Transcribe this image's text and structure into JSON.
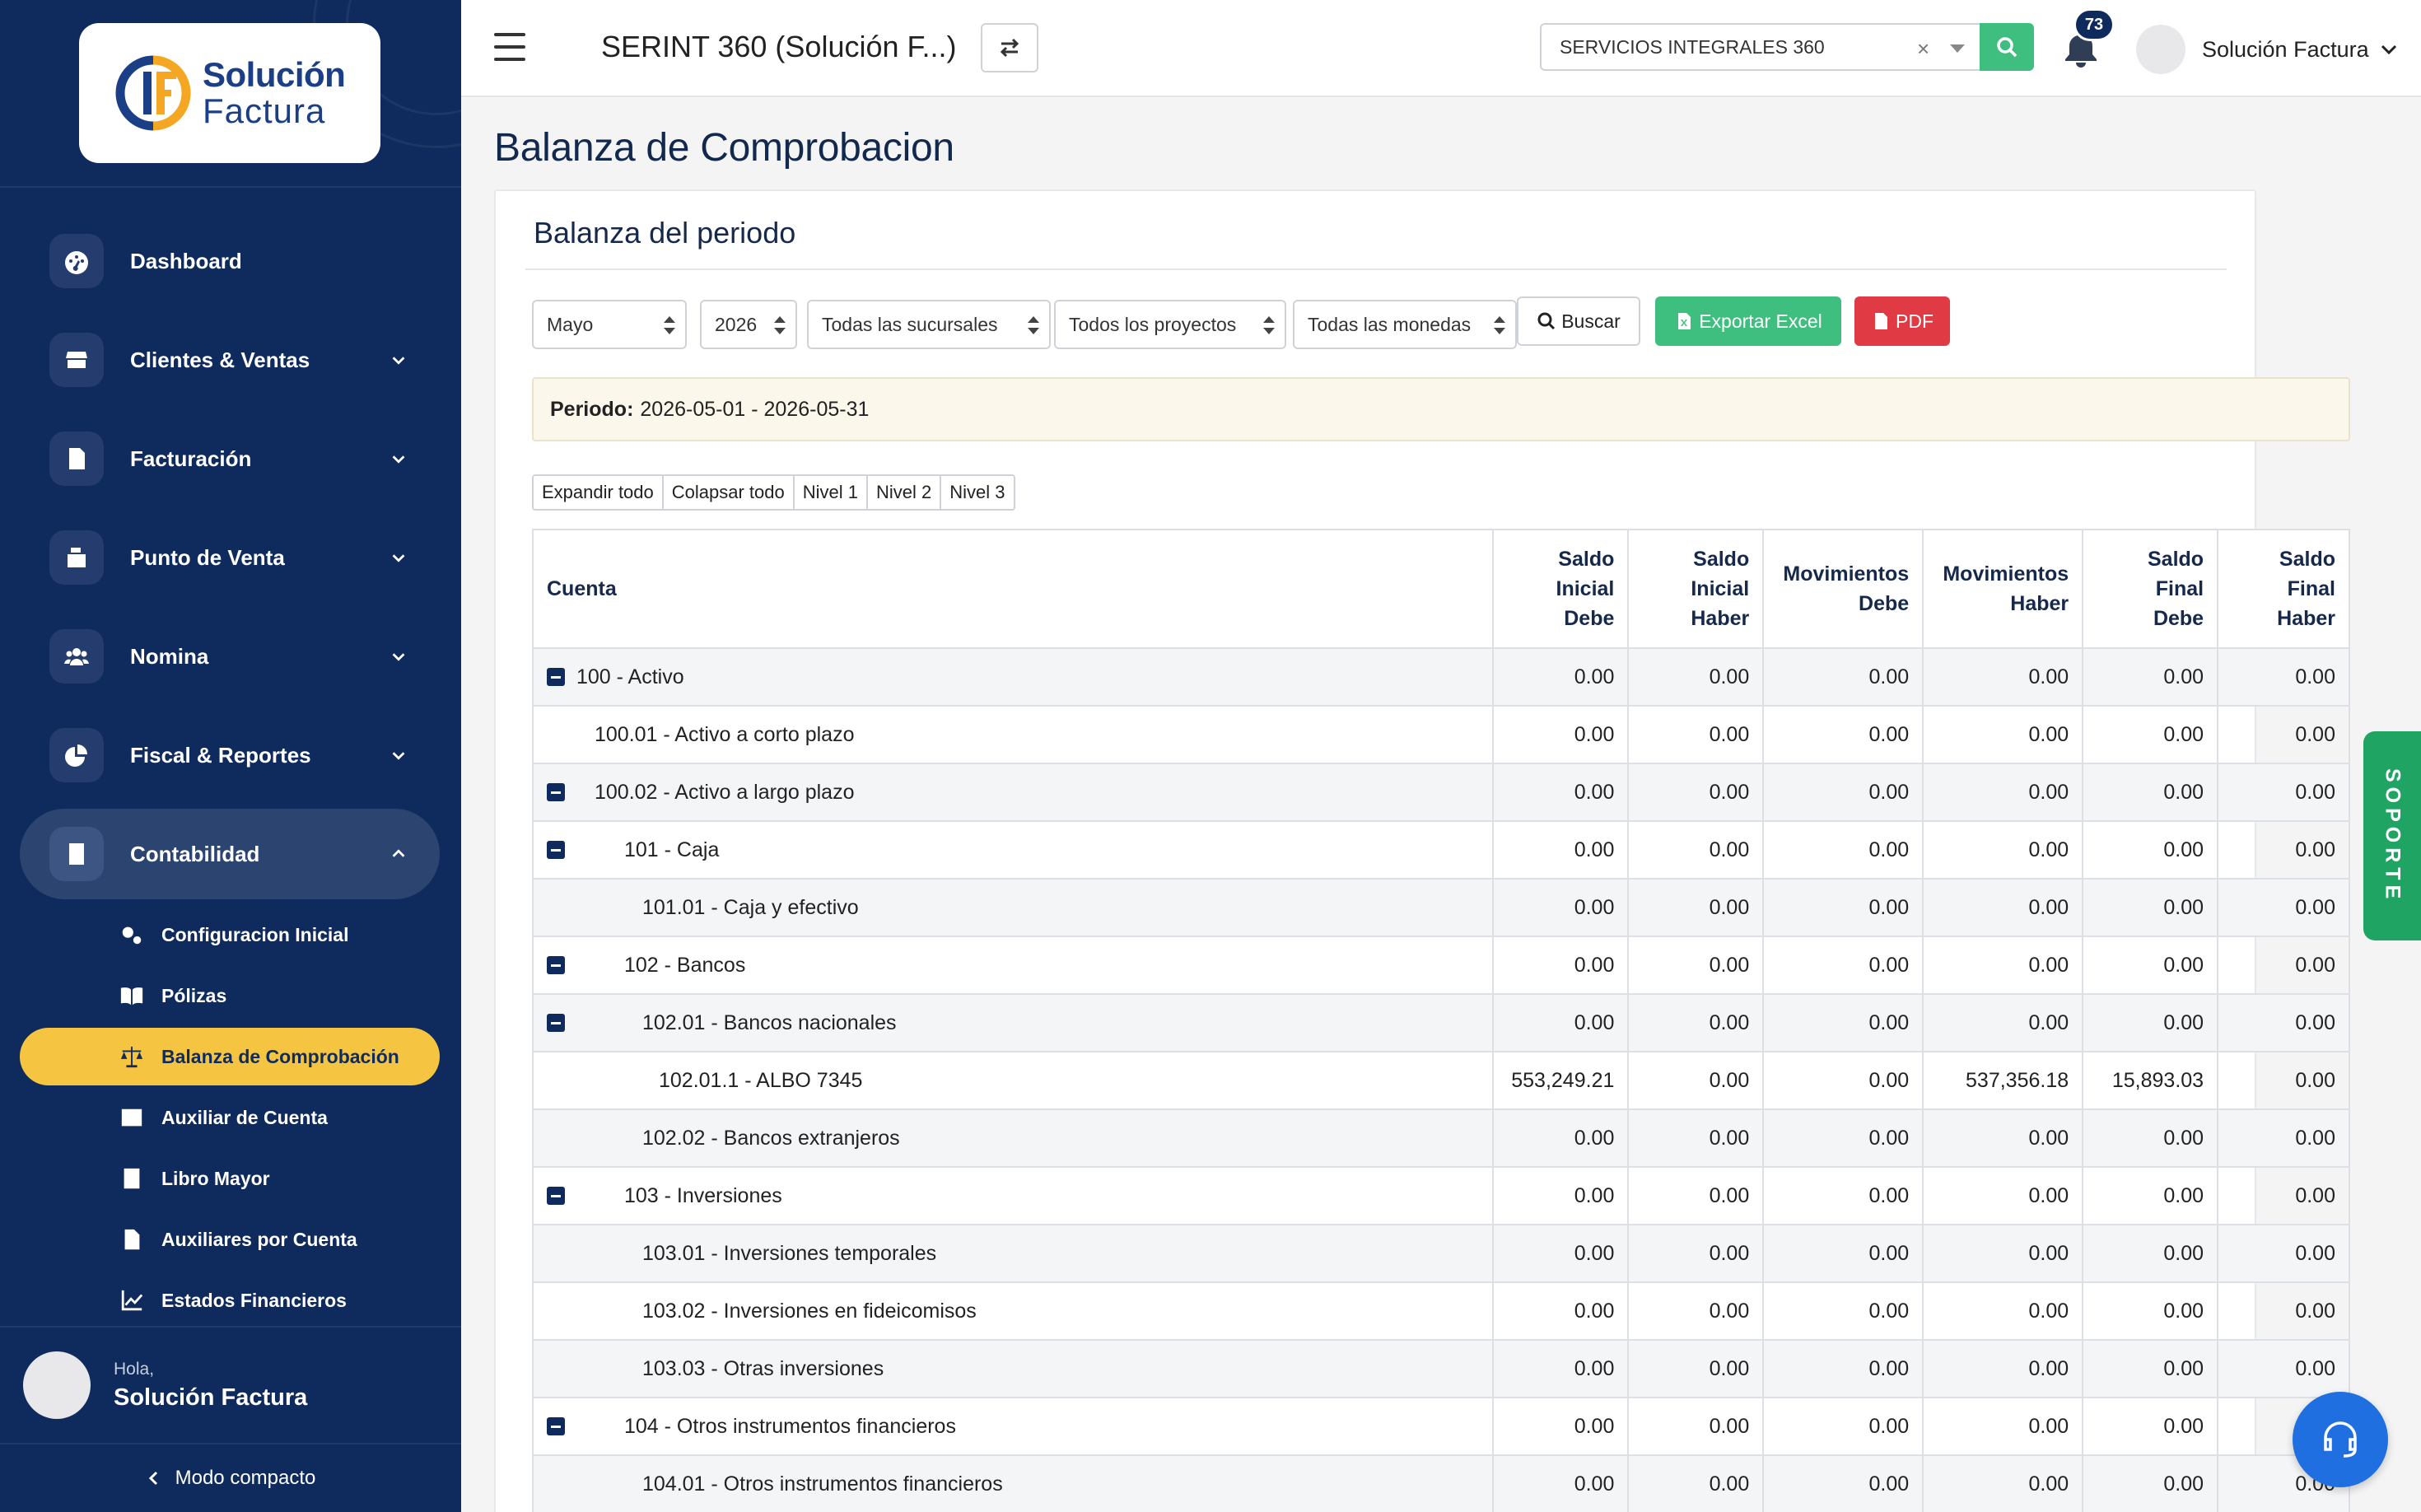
{
  "brand": {
    "logo_line1": "Solución",
    "logo_line2": "Factura"
  },
  "sidebar": {
    "nav": [
      {
        "label": "Dashboard",
        "icon": "dashboard-icon",
        "expandable": false
      },
      {
        "label": "Clientes & Ventas",
        "icon": "store-icon",
        "expandable": true
      },
      {
        "label": "Facturación",
        "icon": "invoice-icon",
        "expandable": true
      },
      {
        "label": "Punto de Venta",
        "icon": "cash-register-icon",
        "expandable": true
      },
      {
        "label": "Nomina",
        "icon": "users-icon",
        "expandable": true
      },
      {
        "label": "Fiscal & Reportes",
        "icon": "pie-chart-icon",
        "expandable": true
      },
      {
        "label": "Contabilidad",
        "icon": "ledger-icon",
        "expandable": true,
        "open": true
      }
    ],
    "sub": [
      {
        "label": "Configuracion Inicial",
        "icon": "cogs-icon"
      },
      {
        "label": "Pólizas",
        "icon": "book-open-icon"
      },
      {
        "label": "Balanza de Comprobación",
        "icon": "scale-icon",
        "active": true
      },
      {
        "label": "Auxiliar de Cuenta",
        "icon": "list-icon"
      },
      {
        "label": "Libro Mayor",
        "icon": "book-icon"
      },
      {
        "label": "Auxiliares por Cuenta",
        "icon": "file-icon"
      },
      {
        "label": "Estados Financieros",
        "icon": "line-chart-icon"
      }
    ],
    "user": {
      "greeting": "Hola,",
      "name": "Solución Factura"
    },
    "compact_label": "Modo compacto"
  },
  "topbar": {
    "company_title": "SERINT 360 (Solución F...)",
    "company_select": "SERVICIOS INTEGRALES 360",
    "notifications": "73",
    "user_name": "Solución Factura"
  },
  "page": {
    "title": "Balanza de Comprobacion",
    "card_title": "Balanza del periodo",
    "filters": {
      "month": "Mayo",
      "year": "2026",
      "branch": "Todas las sucursales",
      "project": "Todos los proyectos",
      "currency": "Todas las monedas"
    },
    "buttons": {
      "search": "Buscar",
      "excel": "Exportar Excel",
      "pdf": "PDF"
    },
    "period_label": "Periodo:",
    "period_value": "2026-05-01 - 2026-05-31",
    "levels": [
      "Expandir todo",
      "Colapsar todo",
      "Nivel 1",
      "Nivel 2",
      "Nivel 3"
    ]
  },
  "table": {
    "headers": {
      "account": "Cuenta",
      "cols": [
        [
          "Saldo",
          "Inicial",
          "Debe"
        ],
        [
          "Saldo",
          "Inicial",
          "Haber"
        ],
        [
          "Movimientos",
          "Debe"
        ],
        [
          "Movimientos",
          "Haber"
        ],
        [
          "Saldo",
          "Final",
          "Debe"
        ],
        [
          "Saldo",
          "Final",
          "Haber"
        ]
      ]
    },
    "rows": [
      {
        "account": "100 - Activo",
        "level": 0,
        "toggle": true,
        "values": [
          "0.00",
          "0.00",
          "0.00",
          "0.00",
          "0.00",
          "0.00"
        ]
      },
      {
        "account": "100.01 - Activo a corto plazo",
        "level": 1,
        "toggle": false,
        "values": [
          "0.00",
          "0.00",
          "0.00",
          "0.00",
          "0.00",
          "0.00"
        ]
      },
      {
        "account": "100.02 - Activo a largo plazo",
        "level": 1,
        "toggle": true,
        "values": [
          "0.00",
          "0.00",
          "0.00",
          "0.00",
          "0.00",
          "0.00"
        ]
      },
      {
        "account": "101 - Caja",
        "level": 2,
        "toggle": true,
        "values": [
          "0.00",
          "0.00",
          "0.00",
          "0.00",
          "0.00",
          "0.00"
        ]
      },
      {
        "account": "101.01 - Caja y efectivo",
        "level": 3,
        "toggle": false,
        "values": [
          "0.00",
          "0.00",
          "0.00",
          "0.00",
          "0.00",
          "0.00"
        ]
      },
      {
        "account": "102 - Bancos",
        "level": 2,
        "toggle": true,
        "values": [
          "0.00",
          "0.00",
          "0.00",
          "0.00",
          "0.00",
          "0.00"
        ]
      },
      {
        "account": "102.01 - Bancos nacionales",
        "level": 3,
        "toggle": true,
        "values": [
          "0.00",
          "0.00",
          "0.00",
          "0.00",
          "0.00",
          "0.00"
        ]
      },
      {
        "account": "102.01.1 - ALBO 7345",
        "level": 4,
        "toggle": false,
        "values": [
          "553,249.21",
          "0.00",
          "0.00",
          "537,356.18",
          "15,893.03",
          "0.00"
        ]
      },
      {
        "account": "102.02 - Bancos extranjeros",
        "level": 3,
        "toggle": false,
        "values": [
          "0.00",
          "0.00",
          "0.00",
          "0.00",
          "0.00",
          "0.00"
        ]
      },
      {
        "account": "103 - Inversiones",
        "level": 2,
        "toggle": true,
        "values": [
          "0.00",
          "0.00",
          "0.00",
          "0.00",
          "0.00",
          "0.00"
        ]
      },
      {
        "account": "103.01 - Inversiones temporales",
        "level": 3,
        "toggle": false,
        "values": [
          "0.00",
          "0.00",
          "0.00",
          "0.00",
          "0.00",
          "0.00"
        ]
      },
      {
        "account": "103.02 - Inversiones en fideicomisos",
        "level": 3,
        "toggle": false,
        "values": [
          "0.00",
          "0.00",
          "0.00",
          "0.00",
          "0.00",
          "0.00"
        ]
      },
      {
        "account": "103.03 - Otras inversiones",
        "level": 3,
        "toggle": false,
        "values": [
          "0.00",
          "0.00",
          "0.00",
          "0.00",
          "0.00",
          "0.00"
        ]
      },
      {
        "account": "104 - Otros instrumentos financieros",
        "level": 2,
        "toggle": true,
        "values": [
          "0.00",
          "0.00",
          "0.00",
          "0.00",
          "0.00",
          "0.00"
        ]
      },
      {
        "account": "104.01 - Otros instrumentos financieros",
        "level": 3,
        "toggle": false,
        "values": [
          "0.00",
          "0.00",
          "0.00",
          "0.00",
          "0.00",
          "0.00"
        ]
      }
    ]
  },
  "soporte_label": "SOPORTE",
  "colors": {
    "sidebar": "#0f2a5c",
    "active": "#f5c542",
    "excel": "#3fbf7f",
    "pdf": "#e03a45",
    "soporte": "#1fa463"
  }
}
